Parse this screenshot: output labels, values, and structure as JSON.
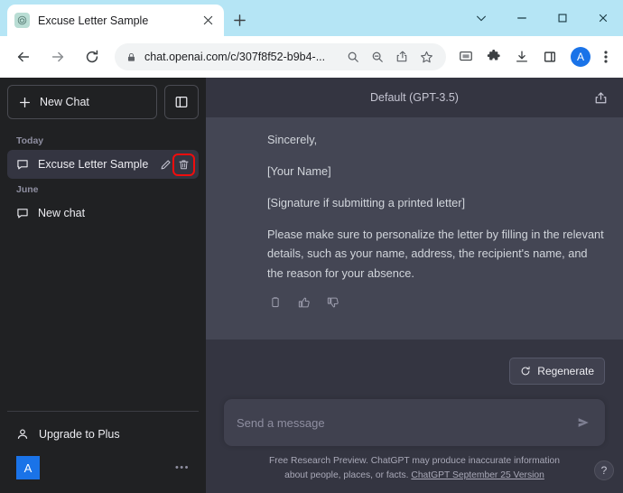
{
  "browser": {
    "tab": {
      "title": "Excuse Letter Sample",
      "favicon_name": "openai-favicon",
      "close_label": "×"
    },
    "new_tab_label": "+",
    "window_controls": [
      {
        "name": "tab-search-button",
        "glyph": "⌄"
      },
      {
        "name": "minimize-button",
        "glyph": "—"
      },
      {
        "name": "maximize-button",
        "glyph": "□"
      },
      {
        "name": "close-window-button",
        "glyph": "✕"
      }
    ],
    "toolbar": {
      "back_label": "←",
      "forward_label": "→",
      "reload_label": "⟳",
      "url": "chat.openai.com/c/307f8f52-b9b4-...",
      "lock_name": "site-lock-icon",
      "omnibox_icons": [
        "search-icon",
        "zoom-out-icon",
        "share-icon",
        "bookmark-star-icon"
      ],
      "right_icons": [
        "screencast-icon",
        "extensions-puzzle-icon",
        "downloads-icon",
        "side-panel-icon"
      ],
      "profile_initial": "A",
      "menu_label": "⋮"
    }
  },
  "sidebar": {
    "new_chat_label": "New Chat",
    "new_chat_icon": "plus-icon",
    "collapse_icon": "sidebar-toggle-icon",
    "groups": [
      {
        "label": "Today",
        "items": [
          {
            "label": "Excuse Letter Sample",
            "icon": "chat-bubble-icon",
            "active": true,
            "actions": [
              "edit-pencil-icon",
              "delete-trash-icon"
            ]
          }
        ]
      },
      {
        "label": "June",
        "items": [
          {
            "label": "New chat",
            "icon": "chat-bubble-icon",
            "active": false,
            "actions": []
          }
        ]
      }
    ],
    "upgrade_label": "Upgrade to Plus",
    "upgrade_icon": "person-icon",
    "account_initial": "A",
    "account_menu_label": "•••",
    "highlight_color": "#f00d0d"
  },
  "main": {
    "model_label": "Default (GPT-3.5)",
    "share_icon": "share-upload-icon",
    "message": {
      "paragraphs": [
        "Sincerely,",
        "[Your Name]",
        "[Signature if submitting a printed letter]",
        "Please make sure to personalize the letter by filling in the relevant details, such as your name, address, the recipient's name, and the reason for your absence."
      ],
      "actions": [
        "copy-icon",
        "thumbs-up-icon",
        "thumbs-down-icon"
      ]
    },
    "regenerate_label": "Regenerate",
    "regenerate_icon": "refresh-icon",
    "input_placeholder": "Send a message",
    "input_value": "",
    "send_icon": "send-arrow-icon",
    "footer_text_1": "Free Research Preview. ChatGPT may produce inaccurate information",
    "footer_text_2": "about people, places, or facts.",
    "footer_link": "ChatGPT September 25 Version",
    "help_label": "?"
  }
}
